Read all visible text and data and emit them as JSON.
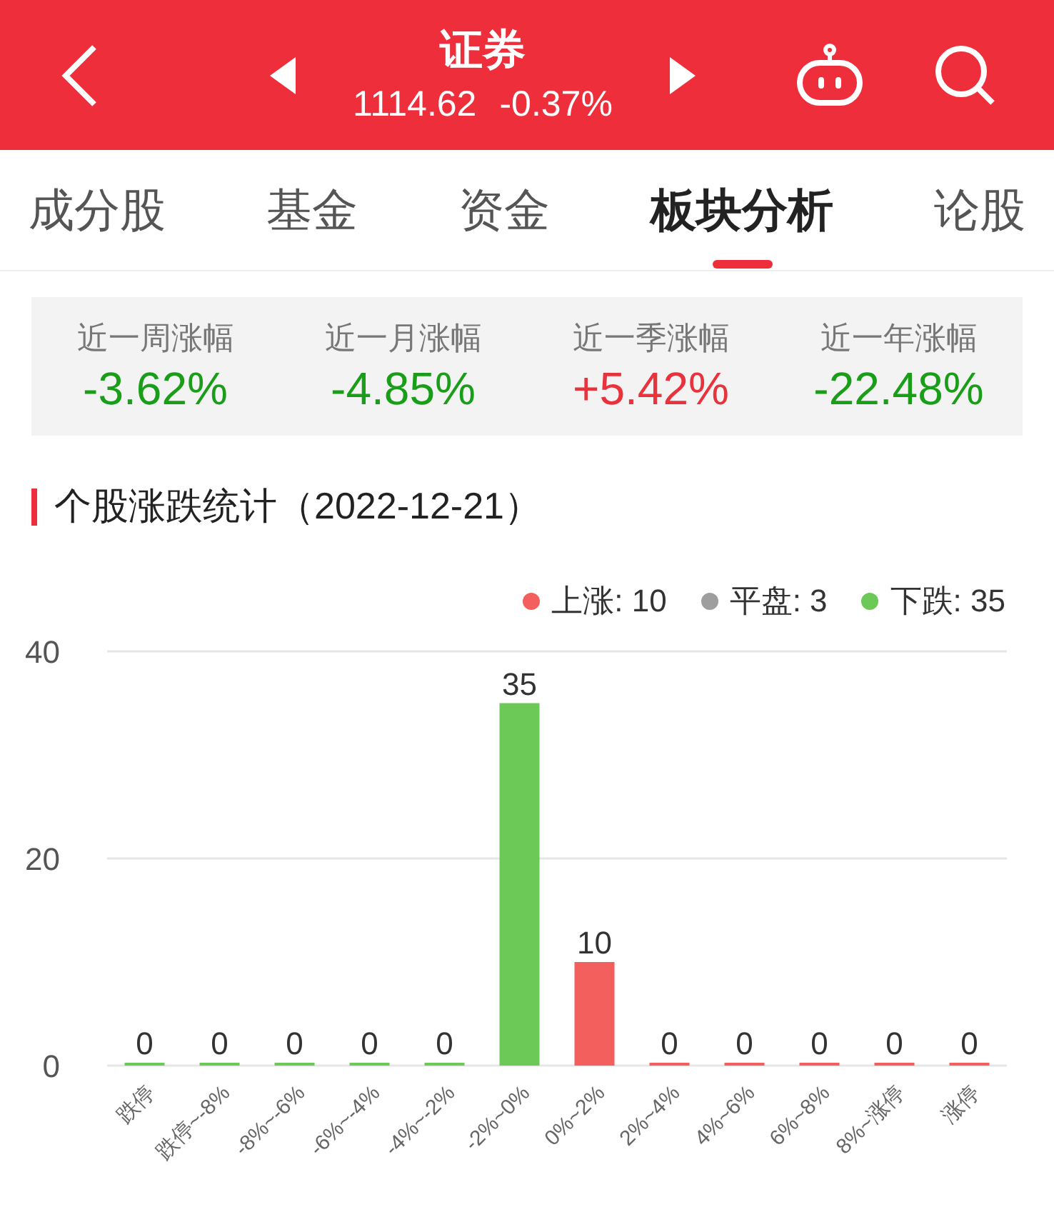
{
  "header": {
    "title": "证券",
    "price": "1114.62",
    "change": "-0.37%"
  },
  "tabs": [
    {
      "label": "成分股",
      "selected": false
    },
    {
      "label": "基金",
      "selected": false
    },
    {
      "label": "资金",
      "selected": false
    },
    {
      "label": "板块分析",
      "selected": true
    },
    {
      "label": "论股",
      "selected": false
    }
  ],
  "stats": [
    {
      "label": "近一周涨幅",
      "value": "-3.62%",
      "kind": "down"
    },
    {
      "label": "近一月涨幅",
      "value": "-4.85%",
      "kind": "down"
    },
    {
      "label": "近一季涨幅",
      "value": "+5.42%",
      "kind": "up"
    },
    {
      "label": "近一年涨幅",
      "value": "-22.48%",
      "kind": "down"
    }
  ],
  "section_title": "个股涨跌统计（2022-12-21）",
  "legend": [
    {
      "label": "上涨: 10",
      "color": "#f25f5c"
    },
    {
      "label": "平盘: 3",
      "color": "#9e9e9e"
    },
    {
      "label": "下跌: 35",
      "color": "#6cc857"
    }
  ],
  "chart_data": {
    "type": "bar",
    "categories": [
      "跌停",
      "跌停~-8%",
      "-8%~-6%",
      "-6%~-4%",
      "-4%~-2%",
      "-2%~0%",
      "0%~2%",
      "2%~4%",
      "4%~6%",
      "6%~8%",
      "8%~涨停",
      "涨停"
    ],
    "series": [
      {
        "color": "#6cc857",
        "values": [
          0,
          0,
          0,
          0,
          0,
          35,
          null,
          null,
          null,
          null,
          null,
          null
        ]
      },
      {
        "color": "#f25f5c",
        "values": [
          null,
          null,
          null,
          null,
          null,
          null,
          10,
          0,
          0,
          0,
          0,
          0
        ]
      }
    ],
    "ylim": [
      0,
      40
    ],
    "yticks": [
      0,
      20,
      40
    ],
    "data_labels": true
  }
}
